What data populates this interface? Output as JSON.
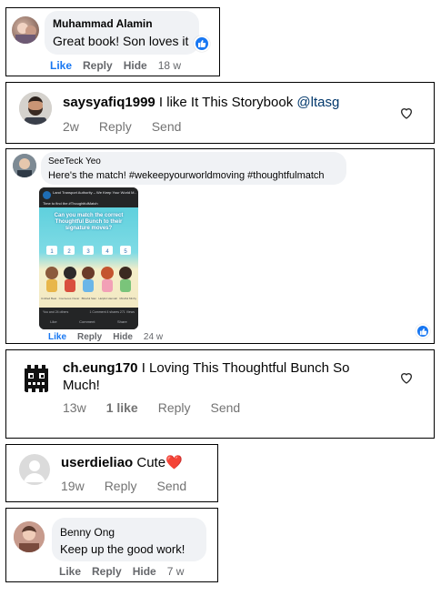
{
  "comments": [
    {
      "author": "Muhammad Alamin",
      "text": "Great book! Son loves it",
      "actions": {
        "like": "Like",
        "reply": "Reply",
        "hide": "Hide",
        "time": "18 w"
      }
    },
    {
      "author": "saysyafiq1999",
      "text": "I like It This Storybook",
      "mention": "@ltasg",
      "actions": {
        "time": "2w",
        "reply": "Reply",
        "send": "Send"
      }
    },
    {
      "author": "SeeTeck Yeo",
      "text": "Here's the match! #wekeepyourworldmoving #thoughtfulmatch",
      "post_card": {
        "org": "Land Transport Authority – We Keep Your World M...",
        "caption": "Time to find the #ThoughtfulMatch",
        "headline": "Can you match the correct Thoughtful Bunch to their signature moves?",
        "names": [
          "Untitled Beat",
          "Courteous Oscar",
          "Blissful Sian",
          "Helpful Hannah",
          "Mindful Minhy"
        ],
        "footer_counts": "You and 24 others",
        "footer_right": "1 Comment  4 shares  271 Views",
        "buttons": [
          "Like",
          "Comment",
          "Share"
        ]
      },
      "actions": {
        "like": "Like",
        "reply": "Reply",
        "hide": "Hide",
        "time": "24 w"
      }
    },
    {
      "author": "ch.eung170",
      "text": "I Loving This Thoughtful Bunch So Much!",
      "actions": {
        "time": "13w",
        "likes": "1 like",
        "reply": "Reply",
        "send": "Send"
      }
    },
    {
      "author": "userdieliao",
      "text": "Cute",
      "emoji": "❤️",
      "actions": {
        "time": "19w",
        "reply": "Reply",
        "send": "Send"
      }
    },
    {
      "author": "Benny Ong",
      "text": "Keep up the good work!",
      "actions": {
        "like": "Like",
        "reply": "Reply",
        "hide": "Hide",
        "time": "7 w"
      }
    }
  ],
  "colors": {
    "fb_blue": "#1877f2",
    "ig_mention": "#00376b",
    "bubble": "#f0f2f5",
    "muted": "#65676b"
  }
}
